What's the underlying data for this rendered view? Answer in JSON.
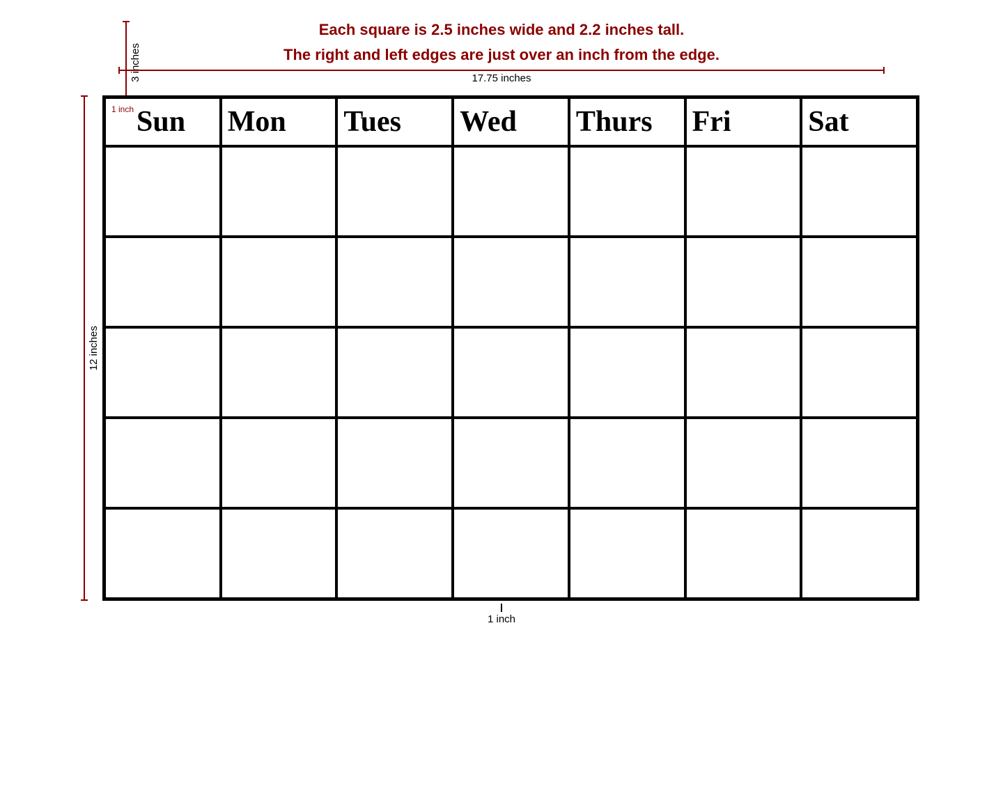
{
  "header": {
    "line1": "Each square is 2.5 inches wide and 2.2 inches tall.",
    "line2": "The right and left edges are just over an inch from the edge.",
    "top_vertical_label": "3 inches",
    "horizontal_label": "17.75 inches",
    "left_vertical_label": "12 inches"
  },
  "calendar": {
    "days": [
      "Sun",
      "Mon",
      "Tues",
      "Wed",
      "Thurs",
      "Fri",
      "Sat"
    ],
    "rows": 5,
    "inch_label": "1 inch"
  },
  "bottom": {
    "label": "1 inch"
  }
}
